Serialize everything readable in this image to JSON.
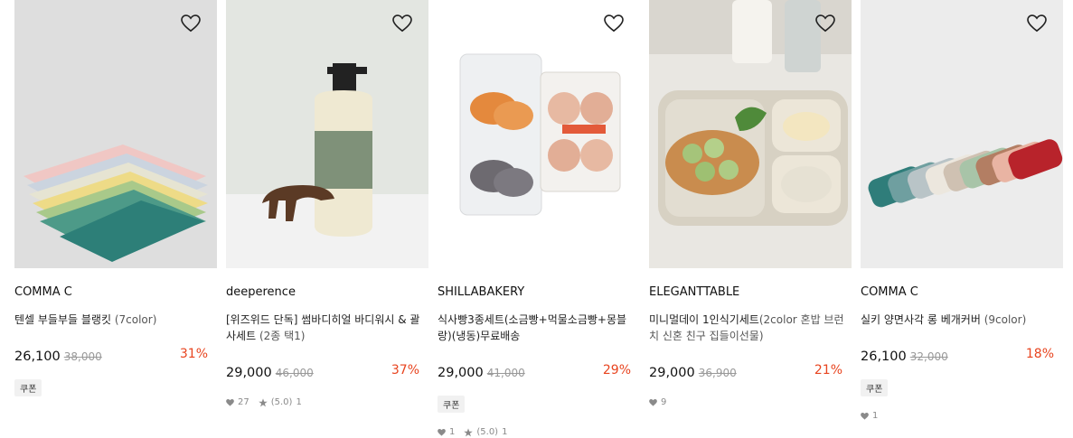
{
  "products": [
    {
      "brand": "COMMA C",
      "name": "텐셀 부들부들 블랭킷",
      "option": "(7color)",
      "price": "26,100",
      "original": "38,000",
      "discount": "31%",
      "coupon": "쿠폰",
      "likes": "",
      "rating": "",
      "reviews": ""
    },
    {
      "brand": "deeperence",
      "name": "[위즈위드 단독] 썸바디히얼 바디워시 & 괄사세트",
      "option": "(2종 택1)",
      "price": "29,000",
      "original": "46,000",
      "discount": "37%",
      "coupon": "",
      "likes": "27",
      "rating": "(5.0)",
      "reviews": "1"
    },
    {
      "brand": "SHILLABAKERY",
      "name": "식사빵3종세트(소금빵+먹물소금빵+몽블랑)(냉동)무료배송",
      "option": "",
      "price": "29,000",
      "original": "41,000",
      "discount": "29%",
      "coupon": "쿠폰",
      "likes": "1",
      "rating": "(5.0)",
      "reviews": "1"
    },
    {
      "brand": "ELEGANTTABLE",
      "name": "미니멀데이 1인식기세트",
      "option": "(2color 혼밥 브런치 신혼 친구 집들이선물)",
      "price": "29,000",
      "original": "36,900",
      "discount": "21%",
      "coupon": "",
      "likes": "9",
      "rating": "",
      "reviews": ""
    },
    {
      "brand": "COMMA C",
      "name": "실키 양면사각 롱 베개커버",
      "option": "(9color)",
      "price": "26,100",
      "original": "32,000",
      "discount": "18%",
      "coupon": "쿠폰",
      "likes": "1",
      "rating": "",
      "reviews": ""
    }
  ],
  "colors": {
    "discount": "#e8441f",
    "price": "#111111",
    "muted": "#999999"
  },
  "icons": {
    "wishlist": "heart-outline-icon",
    "likes": "heart-filled-icon",
    "rating": "star-icon"
  }
}
